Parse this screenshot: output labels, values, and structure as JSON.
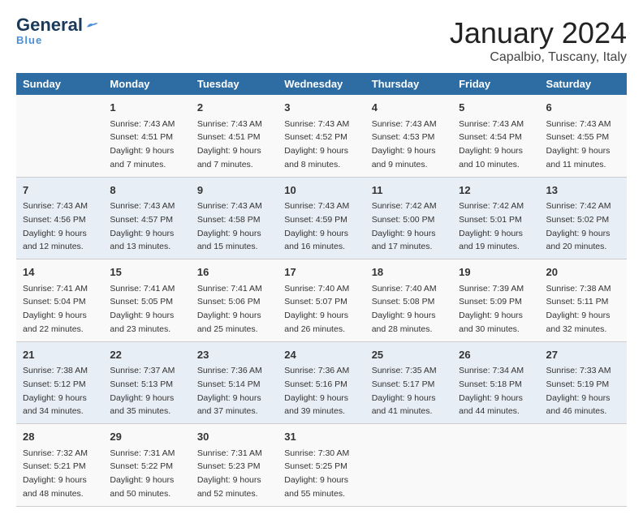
{
  "header": {
    "logo_general": "General",
    "logo_blue": "Blue",
    "month_year": "January 2024",
    "location": "Capalbio, Tuscany, Italy"
  },
  "columns": [
    "Sunday",
    "Monday",
    "Tuesday",
    "Wednesday",
    "Thursday",
    "Friday",
    "Saturday"
  ],
  "weeks": [
    [
      {
        "day": "",
        "sunrise": "",
        "sunset": "",
        "daylight": ""
      },
      {
        "day": "1",
        "sunrise": "Sunrise: 7:43 AM",
        "sunset": "Sunset: 4:51 PM",
        "daylight": "Daylight: 9 hours and 7 minutes."
      },
      {
        "day": "2",
        "sunrise": "Sunrise: 7:43 AM",
        "sunset": "Sunset: 4:51 PM",
        "daylight": "Daylight: 9 hours and 7 minutes."
      },
      {
        "day": "3",
        "sunrise": "Sunrise: 7:43 AM",
        "sunset": "Sunset: 4:52 PM",
        "daylight": "Daylight: 9 hours and 8 minutes."
      },
      {
        "day": "4",
        "sunrise": "Sunrise: 7:43 AM",
        "sunset": "Sunset: 4:53 PM",
        "daylight": "Daylight: 9 hours and 9 minutes."
      },
      {
        "day": "5",
        "sunrise": "Sunrise: 7:43 AM",
        "sunset": "Sunset: 4:54 PM",
        "daylight": "Daylight: 9 hours and 10 minutes."
      },
      {
        "day": "6",
        "sunrise": "Sunrise: 7:43 AM",
        "sunset": "Sunset: 4:55 PM",
        "daylight": "Daylight: 9 hours and 11 minutes."
      }
    ],
    [
      {
        "day": "7",
        "sunrise": "Sunrise: 7:43 AM",
        "sunset": "Sunset: 4:56 PM",
        "daylight": "Daylight: 9 hours and 12 minutes."
      },
      {
        "day": "8",
        "sunrise": "Sunrise: 7:43 AM",
        "sunset": "Sunset: 4:57 PM",
        "daylight": "Daylight: 9 hours and 13 minutes."
      },
      {
        "day": "9",
        "sunrise": "Sunrise: 7:43 AM",
        "sunset": "Sunset: 4:58 PM",
        "daylight": "Daylight: 9 hours and 15 minutes."
      },
      {
        "day": "10",
        "sunrise": "Sunrise: 7:43 AM",
        "sunset": "Sunset: 4:59 PM",
        "daylight": "Daylight: 9 hours and 16 minutes."
      },
      {
        "day": "11",
        "sunrise": "Sunrise: 7:42 AM",
        "sunset": "Sunset: 5:00 PM",
        "daylight": "Daylight: 9 hours and 17 minutes."
      },
      {
        "day": "12",
        "sunrise": "Sunrise: 7:42 AM",
        "sunset": "Sunset: 5:01 PM",
        "daylight": "Daylight: 9 hours and 19 minutes."
      },
      {
        "day": "13",
        "sunrise": "Sunrise: 7:42 AM",
        "sunset": "Sunset: 5:02 PM",
        "daylight": "Daylight: 9 hours and 20 minutes."
      }
    ],
    [
      {
        "day": "14",
        "sunrise": "Sunrise: 7:41 AM",
        "sunset": "Sunset: 5:04 PM",
        "daylight": "Daylight: 9 hours and 22 minutes."
      },
      {
        "day": "15",
        "sunrise": "Sunrise: 7:41 AM",
        "sunset": "Sunset: 5:05 PM",
        "daylight": "Daylight: 9 hours and 23 minutes."
      },
      {
        "day": "16",
        "sunrise": "Sunrise: 7:41 AM",
        "sunset": "Sunset: 5:06 PM",
        "daylight": "Daylight: 9 hours and 25 minutes."
      },
      {
        "day": "17",
        "sunrise": "Sunrise: 7:40 AM",
        "sunset": "Sunset: 5:07 PM",
        "daylight": "Daylight: 9 hours and 26 minutes."
      },
      {
        "day": "18",
        "sunrise": "Sunrise: 7:40 AM",
        "sunset": "Sunset: 5:08 PM",
        "daylight": "Daylight: 9 hours and 28 minutes."
      },
      {
        "day": "19",
        "sunrise": "Sunrise: 7:39 AM",
        "sunset": "Sunset: 5:09 PM",
        "daylight": "Daylight: 9 hours and 30 minutes."
      },
      {
        "day": "20",
        "sunrise": "Sunrise: 7:38 AM",
        "sunset": "Sunset: 5:11 PM",
        "daylight": "Daylight: 9 hours and 32 minutes."
      }
    ],
    [
      {
        "day": "21",
        "sunrise": "Sunrise: 7:38 AM",
        "sunset": "Sunset: 5:12 PM",
        "daylight": "Daylight: 9 hours and 34 minutes."
      },
      {
        "day": "22",
        "sunrise": "Sunrise: 7:37 AM",
        "sunset": "Sunset: 5:13 PM",
        "daylight": "Daylight: 9 hours and 35 minutes."
      },
      {
        "day": "23",
        "sunrise": "Sunrise: 7:36 AM",
        "sunset": "Sunset: 5:14 PM",
        "daylight": "Daylight: 9 hours and 37 minutes."
      },
      {
        "day": "24",
        "sunrise": "Sunrise: 7:36 AM",
        "sunset": "Sunset: 5:16 PM",
        "daylight": "Daylight: 9 hours and 39 minutes."
      },
      {
        "day": "25",
        "sunrise": "Sunrise: 7:35 AM",
        "sunset": "Sunset: 5:17 PM",
        "daylight": "Daylight: 9 hours and 41 minutes."
      },
      {
        "day": "26",
        "sunrise": "Sunrise: 7:34 AM",
        "sunset": "Sunset: 5:18 PM",
        "daylight": "Daylight: 9 hours and 44 minutes."
      },
      {
        "day": "27",
        "sunrise": "Sunrise: 7:33 AM",
        "sunset": "Sunset: 5:19 PM",
        "daylight": "Daylight: 9 hours and 46 minutes."
      }
    ],
    [
      {
        "day": "28",
        "sunrise": "Sunrise: 7:32 AM",
        "sunset": "Sunset: 5:21 PM",
        "daylight": "Daylight: 9 hours and 48 minutes."
      },
      {
        "day": "29",
        "sunrise": "Sunrise: 7:31 AM",
        "sunset": "Sunset: 5:22 PM",
        "daylight": "Daylight: 9 hours and 50 minutes."
      },
      {
        "day": "30",
        "sunrise": "Sunrise: 7:31 AM",
        "sunset": "Sunset: 5:23 PM",
        "daylight": "Daylight: 9 hours and 52 minutes."
      },
      {
        "day": "31",
        "sunrise": "Sunrise: 7:30 AM",
        "sunset": "Sunset: 5:25 PM",
        "daylight": "Daylight: 9 hours and 55 minutes."
      },
      {
        "day": "",
        "sunrise": "",
        "sunset": "",
        "daylight": ""
      },
      {
        "day": "",
        "sunrise": "",
        "sunset": "",
        "daylight": ""
      },
      {
        "day": "",
        "sunrise": "",
        "sunset": "",
        "daylight": ""
      }
    ]
  ]
}
